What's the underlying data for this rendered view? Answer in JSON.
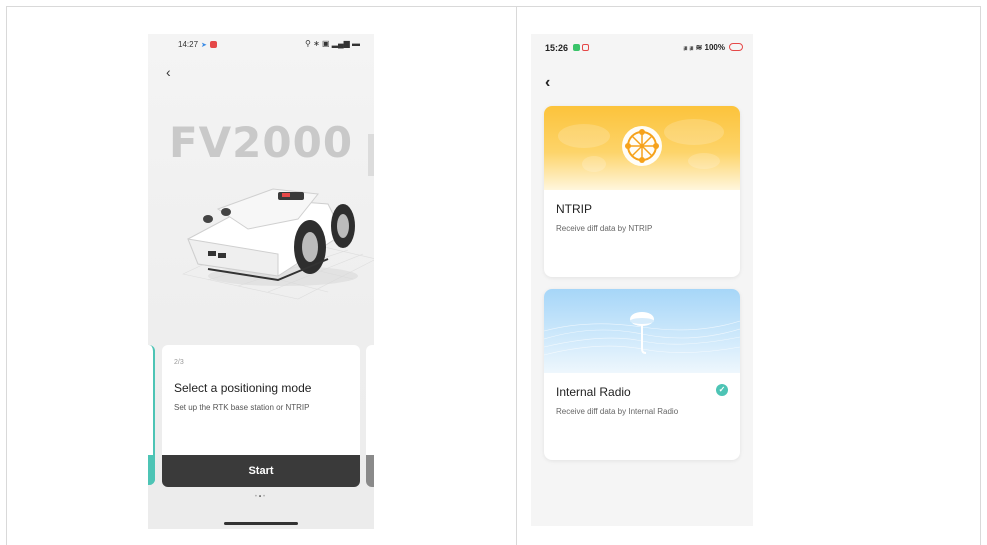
{
  "left_screen": {
    "status_bar": {
      "time": "14:27",
      "icons": "⚲ ∗ ▣ ▂▄▆ ▬"
    },
    "back_icon": "‹",
    "model_name": "FV2000",
    "card": {
      "step": "2/3",
      "title": "Select a positioning mode",
      "subtitle": "Set up the RTK base station or NTRIP",
      "button": "Start"
    },
    "pager": {
      "dots": "•",
      "active": "•"
    }
  },
  "right_screen": {
    "status_bar": {
      "time": "15:26",
      "icons": "ᵢₗₗ ᵢₗₗ ≋ 100%"
    },
    "back_icon": "‹",
    "options": [
      {
        "title": "NTRIP",
        "subtitle": "Receive diff data by NTRIP",
        "selected": false
      },
      {
        "title": "Internal Radio",
        "subtitle": "Receive diff data by Internal Radio",
        "selected": true
      }
    ],
    "check_glyph": "✓"
  },
  "colors": {
    "accent": "#4dc4b5",
    "ntrip_banner": "#fcc33b",
    "radio_banner": "#a6d6f8",
    "button": "#3a3a3a"
  }
}
